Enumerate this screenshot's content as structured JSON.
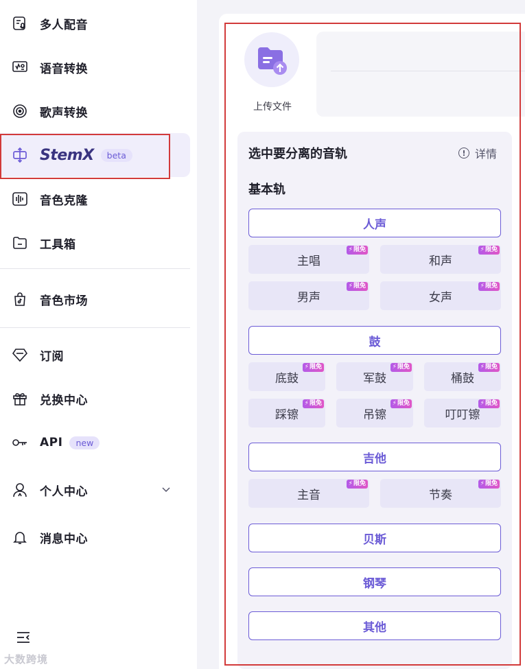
{
  "sidebar": {
    "items": [
      {
        "label": "多人配音",
        "icon": "multi-voice-icon"
      },
      {
        "label": "语音转换",
        "icon": "voice-convert-icon"
      },
      {
        "label": "歌声转换",
        "icon": "vinyl-icon"
      },
      {
        "label": "StemX",
        "badge": "beta",
        "icon": "stem-split-icon",
        "active": true
      },
      {
        "label": "音色克隆",
        "icon": "waveform-icon"
      },
      {
        "label": "工具箱",
        "icon": "folder-icon"
      },
      {
        "label": "音色市场",
        "icon": "market-bag-icon"
      },
      {
        "label": "订阅",
        "icon": "diamond-icon"
      },
      {
        "label": "兑换中心",
        "icon": "gift-icon"
      },
      {
        "label": "API",
        "badge": "new",
        "icon": "key-icon"
      },
      {
        "label": "个人中心",
        "icon": "user-icon"
      },
      {
        "label": "消息中心",
        "icon": "bell-icon"
      }
    ],
    "watermark": "大数跨境"
  },
  "upload": {
    "label": "上传文件"
  },
  "tracks": {
    "title": "选中要分离的音轨",
    "details_label": "详情",
    "basic_title": "基本轨",
    "free_tag": "限免",
    "groups": [
      {
        "label": "人声",
        "subs": [
          "主唱",
          "和声",
          "男声",
          "女声"
        ]
      },
      {
        "label": "鼓",
        "subs": [
          "底鼓",
          "军鼓",
          "桶鼓",
          "踩镲",
          "吊镲",
          "叮叮镲"
        ]
      },
      {
        "label": "吉他",
        "subs": [
          "主音",
          "节奏"
        ]
      },
      {
        "label": "贝斯",
        "subs": []
      },
      {
        "label": "钢琴",
        "subs": []
      },
      {
        "label": "其他",
        "subs": []
      }
    ]
  },
  "colors": {
    "accent": "#6b5bd6",
    "highlight_box": "#d23a3a",
    "free_tag": "#c653de"
  }
}
